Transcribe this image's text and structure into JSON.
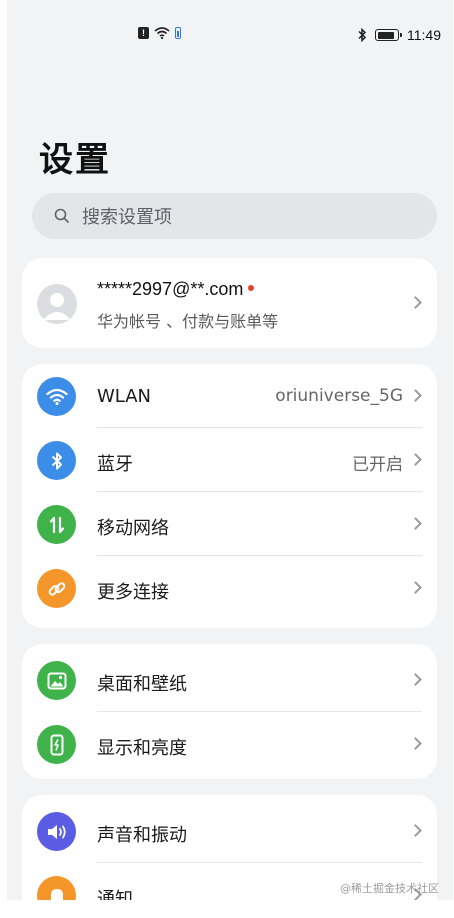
{
  "status_bar": {
    "time": "11:49",
    "left_icons": [
      "alert-icon",
      "wifi-icon",
      "battery-saver-icon"
    ],
    "right_icons": [
      "bluetooth-icon",
      "battery-icon"
    ]
  },
  "page": {
    "title": "设置"
  },
  "search": {
    "placeholder": "搜索设置项"
  },
  "account": {
    "name": "*****2997@**.com",
    "subtitle": "华为帐号 、付款与账单等"
  },
  "groups": {
    "network": [
      {
        "label": "WLAN",
        "value": "oriuniverse_5G",
        "icon": "wifi-icon",
        "color": "#3b8de8"
      },
      {
        "label": "蓝牙",
        "value": "已开启",
        "icon": "bluetooth-icon",
        "color": "#3b8de8"
      },
      {
        "label": "移动网络",
        "value": "",
        "icon": "mobile-data-icon",
        "color": "#3fb349"
      },
      {
        "label": "更多连接",
        "value": "",
        "icon": "link-icon",
        "color": "#f5962b"
      }
    ],
    "display": [
      {
        "label": "桌面和壁纸",
        "icon": "wallpaper-icon",
        "color": "#3fb349"
      },
      {
        "label": "显示和亮度",
        "icon": "brightness-icon",
        "color": "#3fb349"
      }
    ],
    "sound": [
      {
        "label": "声音和振动",
        "icon": "volume-icon",
        "color": "#5b5ce6"
      },
      {
        "label": "通知",
        "icon": "notification-icon",
        "color": "#f5962b"
      }
    ]
  },
  "watermark": "@稀土掘金技术社区"
}
